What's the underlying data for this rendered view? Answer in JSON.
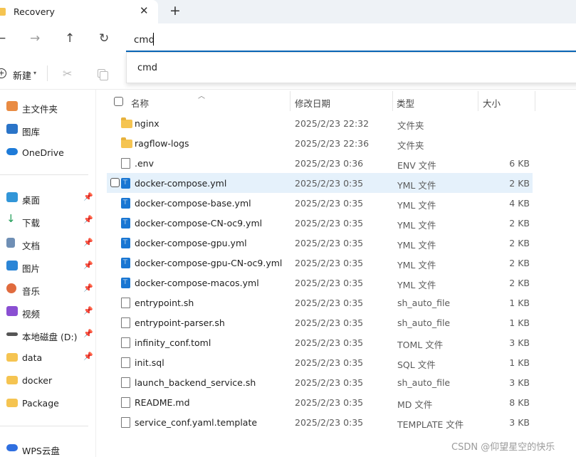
{
  "window": {
    "tab_title": "Recovery"
  },
  "address_bar": {
    "value": "cmd",
    "suggestions": [
      "cmd"
    ]
  },
  "toolbar": {
    "new_label": "新建"
  },
  "sidebar": {
    "items": [
      {
        "label": "主文件夹",
        "icon": "home-icon",
        "pinned": false,
        "color": "#e98b43"
      },
      {
        "label": "图库",
        "icon": "gallery-icon",
        "pinned": false,
        "color": "#2a74c8"
      },
      {
        "label": "OneDrive",
        "icon": "cloud-icon",
        "pinned": false,
        "color": "#1e7bd8"
      },
      {
        "label": "桌面",
        "icon": "desktop-icon",
        "pinned": true,
        "color": "#3296d8"
      },
      {
        "label": "下载",
        "icon": "download-icon",
        "pinned": true,
        "color": "#1e9c56"
      },
      {
        "label": "文档",
        "icon": "documents-icon",
        "pinned": true,
        "color": "#6f8fb5"
      },
      {
        "label": "图片",
        "icon": "pictures-icon",
        "pinned": true,
        "color": "#2b85d6"
      },
      {
        "label": "音乐",
        "icon": "music-icon",
        "pinned": true,
        "color": "#e06b3e"
      },
      {
        "label": "视频",
        "icon": "videos-icon",
        "pinned": true,
        "color": "#8a4fd2"
      },
      {
        "label": "本地磁盘 (D:)",
        "icon": "drive-icon",
        "pinned": true,
        "color": "#555555"
      },
      {
        "label": "data",
        "icon": "folder-icon",
        "pinned": true,
        "color": "#f5c451"
      },
      {
        "label": "docker",
        "icon": "folder-icon",
        "pinned": false,
        "color": "#f5c451"
      },
      {
        "label": "Package",
        "icon": "folder-icon",
        "pinned": false,
        "color": "#f5c451"
      },
      {
        "label": "WPS云盘",
        "icon": "wps-cloud-icon",
        "pinned": false,
        "color": "#2f6fe0"
      }
    ]
  },
  "columns": {
    "name": "名称",
    "modified": "修改日期",
    "type": "类型",
    "size": "大小"
  },
  "files": [
    {
      "name": "nginx",
      "modified": "2025/2/23 22:32",
      "type": "文件夹",
      "size": "",
      "icon": "folder"
    },
    {
      "name": "ragflow-logs",
      "modified": "2025/2/23 22:36",
      "type": "文件夹",
      "size": "",
      "icon": "folder"
    },
    {
      "name": ".env",
      "modified": "2025/2/23 0:36",
      "type": "ENV 文件",
      "size": "6 KB",
      "icon": "doc"
    },
    {
      "name": "docker-compose.yml",
      "modified": "2025/2/23 0:35",
      "type": "YML 文件",
      "size": "2 KB",
      "icon": "yml",
      "selected": true
    },
    {
      "name": "docker-compose-base.yml",
      "modified": "2025/2/23 0:35",
      "type": "YML 文件",
      "size": "4 KB",
      "icon": "yml"
    },
    {
      "name": "docker-compose-CN-oc9.yml",
      "modified": "2025/2/23 0:35",
      "type": "YML 文件",
      "size": "2 KB",
      "icon": "yml"
    },
    {
      "name": "docker-compose-gpu.yml",
      "modified": "2025/2/23 0:35",
      "type": "YML 文件",
      "size": "2 KB",
      "icon": "yml"
    },
    {
      "name": "docker-compose-gpu-CN-oc9.yml",
      "modified": "2025/2/23 0:35",
      "type": "YML 文件",
      "size": "2 KB",
      "icon": "yml"
    },
    {
      "name": "docker-compose-macos.yml",
      "modified": "2025/2/23 0:35",
      "type": "YML 文件",
      "size": "2 KB",
      "icon": "yml"
    },
    {
      "name": "entrypoint.sh",
      "modified": "2025/2/23 0:35",
      "type": "sh_auto_file",
      "size": "1 KB",
      "icon": "doc"
    },
    {
      "name": "entrypoint-parser.sh",
      "modified": "2025/2/23 0:35",
      "type": "sh_auto_file",
      "size": "1 KB",
      "icon": "doc"
    },
    {
      "name": "infinity_conf.toml",
      "modified": "2025/2/23 0:35",
      "type": "TOML 文件",
      "size": "3 KB",
      "icon": "doc"
    },
    {
      "name": "init.sql",
      "modified": "2025/2/23 0:35",
      "type": "SQL 文件",
      "size": "1 KB",
      "icon": "doc"
    },
    {
      "name": "launch_backend_service.sh",
      "modified": "2025/2/23 0:35",
      "type": "sh_auto_file",
      "size": "3 KB",
      "icon": "doc"
    },
    {
      "name": "README.md",
      "modified": "2025/2/23 0:35",
      "type": "MD 文件",
      "size": "8 KB",
      "icon": "doc"
    },
    {
      "name": "service_conf.yaml.template",
      "modified": "2025/2/23 0:35",
      "type": "TEMPLATE 文件",
      "size": "3 KB",
      "icon": "doc"
    }
  ],
  "watermark": "CSDN @仰望星空的快乐"
}
